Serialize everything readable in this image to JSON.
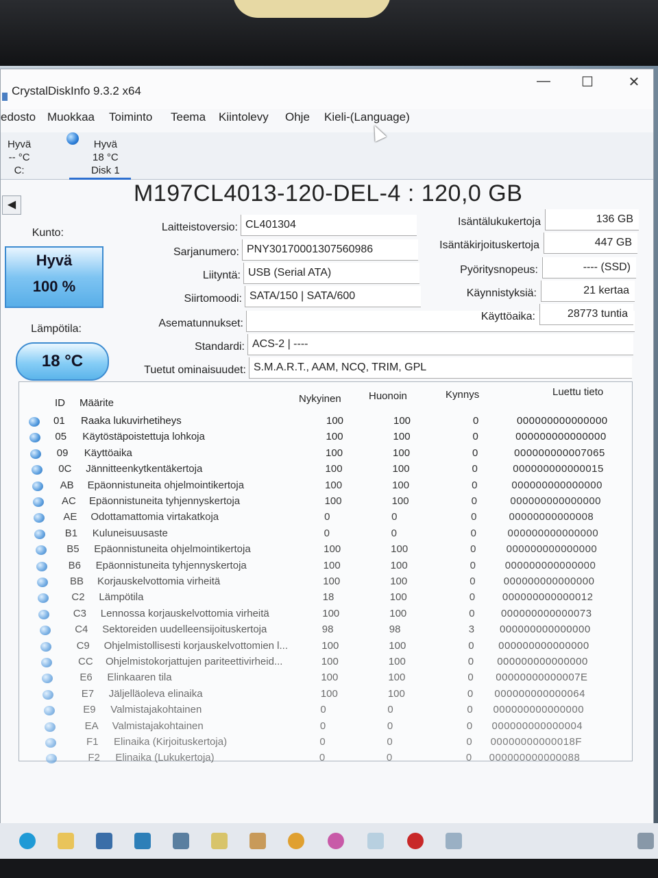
{
  "window": {
    "title": "CrystalDiskInfo 9.3.2 x64",
    "minimize_glyph": "—",
    "maximize_glyph": "☐",
    "close_glyph": "✕"
  },
  "menu": [
    "edosto",
    "Muokkaa",
    "Toiminto",
    "Teema",
    "Kiintolevy",
    "Ohje",
    "Kieli-(Language)"
  ],
  "disks": [
    {
      "status": "Hyvä",
      "temp": "-- °C",
      "name": "C:"
    },
    {
      "status": "Hyvä",
      "temp": "18 °C",
      "name": "Disk 1"
    }
  ],
  "model_title": "M197CL4013-120-DEL-4 : 120,0 GB",
  "health": {
    "label": "Kunto:",
    "status": "Hyvä",
    "percent": "100 %"
  },
  "temperature": {
    "label": "Lämpötila:",
    "value": "18 °C"
  },
  "info": {
    "firmware": {
      "label": "Laitteistoversio:",
      "value": "CL401304"
    },
    "serial": {
      "label": "Sarjanumero:",
      "value": "PNY30170001307560986"
    },
    "interface": {
      "label": "Liityntä:",
      "value": "USB (Serial ATA)"
    },
    "transfer": {
      "label": "Siirtomoodi:",
      "value": "SATA/150 | SATA/600"
    },
    "drive_letters": {
      "label": "Asematunnukset:",
      "value": ""
    },
    "standard": {
      "label": "Standardi:",
      "value": "ACS-2 | ----"
    },
    "features": {
      "label": "Tuetut ominaisuudet:",
      "value": "S.M.A.R.T., AAM, NCQ, TRIM, GPL"
    }
  },
  "stats": {
    "host_reads": {
      "label": "Isäntälukukertoja",
      "value": "136 GB"
    },
    "host_writes": {
      "label": "Isäntäkirjoituskertoja",
      "value": "447 GB"
    },
    "rotation": {
      "label": "Pyöritysnopeus:",
      "value": "---- (SSD)"
    },
    "power_on_count": {
      "label": "Käynnistyksiä:",
      "value": "21 kertaa"
    },
    "power_on_hours": {
      "label": "Käyttöaika:",
      "value": "28773 tuntia"
    }
  },
  "smart_headers": {
    "id": "ID",
    "attr": "Määrite",
    "current": "Nykyinen",
    "worst": "Huonoin",
    "threshold": "Kynnys",
    "raw": "Luettu tieto"
  },
  "smart_rows": [
    {
      "id": "01",
      "name": "Raaka lukuvirhetiheys",
      "cur": "100",
      "worst": "100",
      "thr": "0",
      "raw": "000000000000000"
    },
    {
      "id": "05",
      "name": "Käytöstäpoistettuja lohkoja",
      "cur": "100",
      "worst": "100",
      "thr": "0",
      "raw": "000000000000000"
    },
    {
      "id": "09",
      "name": "Käyttöaika",
      "cur": "100",
      "worst": "100",
      "thr": "0",
      "raw": "000000000007065"
    },
    {
      "id": "0C",
      "name": "Jännitteenkytkentäkertoja",
      "cur": "100",
      "worst": "100",
      "thr": "0",
      "raw": "000000000000015"
    },
    {
      "id": "AB",
      "name": "Epäonnistuneita ohjelmointikertoja",
      "cur": "100",
      "worst": "100",
      "thr": "0",
      "raw": "000000000000000"
    },
    {
      "id": "AC",
      "name": "Epäonnistuneita tyhjennyskertoja",
      "cur": "100",
      "worst": "100",
      "thr": "0",
      "raw": "000000000000000"
    },
    {
      "id": "AE",
      "name": "Odottamattomia virtakatkoja",
      "cur": "0",
      "worst": "0",
      "thr": "0",
      "raw": "00000000000008"
    },
    {
      "id": "B1",
      "name": "Kuluneisuusaste",
      "cur": "0",
      "worst": "0",
      "thr": "0",
      "raw": "000000000000000"
    },
    {
      "id": "B5",
      "name": "Epäonnistuneita ohjelmointikertoja",
      "cur": "100",
      "worst": "100",
      "thr": "0",
      "raw": "000000000000000"
    },
    {
      "id": "B6",
      "name": "Epäonnistuneita tyhjennyskertoja",
      "cur": "100",
      "worst": "100",
      "thr": "0",
      "raw": "000000000000000"
    },
    {
      "id": "BB",
      "name": "Korjauskelvottomia virheitä",
      "cur": "100",
      "worst": "100",
      "thr": "0",
      "raw": "000000000000000"
    },
    {
      "id": "C2",
      "name": "Lämpötila",
      "cur": "18",
      "worst": "100",
      "thr": "0",
      "raw": "000000000000012"
    },
    {
      "id": "C3",
      "name": "Lennossa korjauskelvottomia virheitä",
      "cur": "100",
      "worst": "100",
      "thr": "0",
      "raw": "000000000000073"
    },
    {
      "id": "C4",
      "name": "Sektoreiden uudelleensijoituskertoja",
      "cur": "98",
      "worst": "98",
      "thr": "3",
      "raw": "000000000000000"
    },
    {
      "id": "C9",
      "name": "Ohjelmistollisesti korjauskelvottomien l...",
      "cur": "100",
      "worst": "100",
      "thr": "0",
      "raw": "000000000000000"
    },
    {
      "id": "CC",
      "name": "Ohjelmistokorjattujen pariteettivirheid...",
      "cur": "100",
      "worst": "100",
      "thr": "0",
      "raw": "000000000000000"
    },
    {
      "id": "E6",
      "name": "Elinkaaren tila",
      "cur": "100",
      "worst": "100",
      "thr": "0",
      "raw": "00000000000007E"
    },
    {
      "id": "E7",
      "name": "Jäljelläoleva elinaika",
      "cur": "100",
      "worst": "100",
      "thr": "0",
      "raw": "000000000000064"
    },
    {
      "id": "E9",
      "name": "Valmistajakohtainen",
      "cur": "0",
      "worst": "0",
      "thr": "0",
      "raw": "000000000000000"
    },
    {
      "id": "EA",
      "name": "Valmistajakohtainen",
      "cur": "0",
      "worst": "0",
      "thr": "0",
      "raw": "000000000000004"
    },
    {
      "id": "F1",
      "name": "Elinaika (Kirjoituskertoja)",
      "cur": "0",
      "worst": "0",
      "thr": "0",
      "raw": "00000000000018F"
    },
    {
      "id": "F2",
      "name": "Elinaika (Lukukertoja)",
      "cur": "0",
      "worst": "0",
      "thr": "0",
      "raw": "000000000000088"
    }
  ],
  "taskbar": [
    "start-icon",
    "file-explorer-icon",
    "store-icon",
    "mail-icon",
    "network-icon",
    "photos-icon",
    "paint-icon",
    "chrome-icon",
    "flower-app-icon",
    "crystaldiskinfo-icon",
    "red-app-icon",
    "pen-icon",
    "tray-icon"
  ],
  "colors": {
    "accent": "#2d7fd8",
    "health_bg": "#7ec4f2"
  }
}
